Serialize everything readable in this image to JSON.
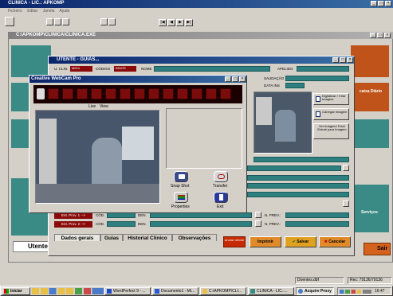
{
  "app": {
    "title": "CLINICA - LIC.: APKOMP",
    "menu": [
      "Ficheiro",
      "Editar",
      "Janela",
      "Ajuda"
    ]
  },
  "mdi": {
    "title": "C:\\APKOMP\\CLINICA\\CLINICA.EXE"
  },
  "utente": {
    "title": "UTENTE - GUIAS...",
    "u_clin_label": "U. CLIN.",
    "u_clin_value": "MEDI",
    "codigo_label": "CÓDIGO",
    "codigo_value": "BRATE",
    "nome_label": "NOME",
    "apelido_label": "APELIDO",
    "saudacao_label": "SAUDAÇÃO",
    "data_ins_label": "DATA INS",
    "digitalizar_label": "Digitalizar / Criar Imagem",
    "carregar_label": "Carregar Imagem",
    "ver_label": "Ver Imagem/ Foto/ Extrair para Imagem",
    "ent_prov1": "Ent. Prov. 1 -->",
    "ent_prov2": "Ent. Prov. 2 -->",
    "cod_label": "CÓD.",
    "den_label": "DEN.",
    "nprev_label": "N. PREV.:",
    "tabs": [
      "Dados gerais",
      "Guias",
      "Historial Clinico",
      "Observações"
    ],
    "buttons": {
      "anular": "Anular Utente",
      "imprimir": "Imprimir",
      "salvar": "Salvar",
      "cancelar": "Cancelar"
    }
  },
  "webcam": {
    "title": "Creative WebCam Pro",
    "live_label": "Live",
    "view_label": "View",
    "snapshot_label": "Snap Shot",
    "transfer_label": "Transfer",
    "properties_label": "Properties",
    "exit_label": "Exit"
  },
  "background": {
    "utente_label": "Utente",
    "sair_label": "Sair",
    "caixa_label": "caixa Diário",
    "servicos_label": "Serviços"
  },
  "status": {
    "file": "Doentes.dbf",
    "rec": "Rec: 79136/79136"
  },
  "taskbar": {
    "start": "Iniciar",
    "tasks": [
      "WordPerfect 9 - ...",
      "Documento1 - Mi...",
      "C:\\APKOMP\\CLI...",
      "CLINICA - LIC.:...",
      "Acquire Proxy"
    ],
    "clock": "16:47"
  },
  "colors": {
    "teal": "#3a8a86",
    "dark_teal": "#2e7f7f",
    "film": "#7a0c0c",
    "accent_red": "#c62a00",
    "title_blue": "#0a246a"
  }
}
